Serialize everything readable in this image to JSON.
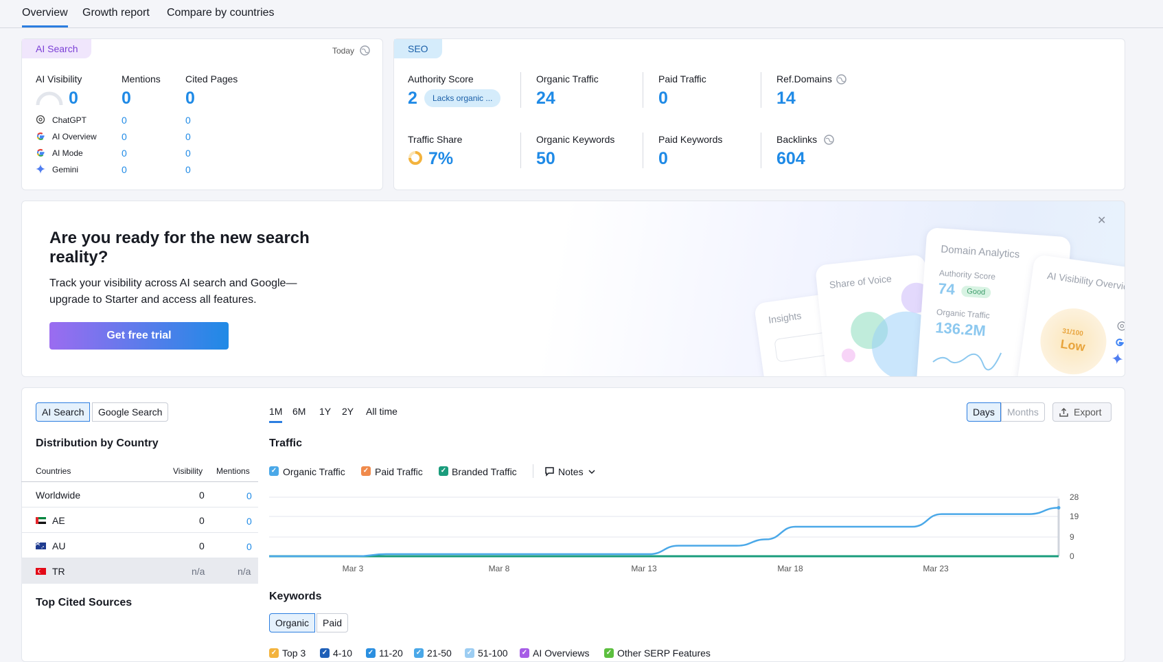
{
  "tabs": [
    "Overview",
    "Growth report",
    "Compare by countries"
  ],
  "ai_card": {
    "pill": "AI Search",
    "today": "Today",
    "cols": [
      "AI Visibility",
      "Mentions",
      "Cited Pages"
    ],
    "totals": [
      "0",
      "0",
      "0"
    ],
    "rows": [
      {
        "name": "ChatGPT",
        "mentions": "0",
        "cited": "0"
      },
      {
        "name": "AI Overview",
        "mentions": "0",
        "cited": "0"
      },
      {
        "name": "AI Mode",
        "mentions": "0",
        "cited": "0"
      },
      {
        "name": "Gemini",
        "mentions": "0",
        "cited": "0"
      }
    ]
  },
  "seo_card": {
    "pill": "SEO",
    "authority_label": "Authority Score",
    "authority_value": "2",
    "authority_chip": "Lacks organic ...",
    "organic_traffic_label": "Organic Traffic",
    "organic_traffic_value": "24",
    "paid_traffic_label": "Paid Traffic",
    "paid_traffic_value": "0",
    "ref_domains_label": "Ref.Domains",
    "ref_domains_value": "14",
    "traffic_share_label": "Traffic Share",
    "traffic_share_value": "7%",
    "organic_keywords_label": "Organic Keywords",
    "organic_keywords_value": "50",
    "paid_keywords_label": "Paid Keywords",
    "paid_keywords_value": "0",
    "backlinks_label": "Backlinks",
    "backlinks_value": "604"
  },
  "promo": {
    "title": "Are you ready for the new search reality?",
    "text": "Track your visibility across AI search and Google—upgrade to Starter and access all features.",
    "cta": "Get free trial",
    "illus": {
      "insights": "Insights",
      "share_of_voice": "Share of Voice",
      "domain_analytics": "Domain Analytics",
      "authority_score": "Authority Score",
      "authority_value": "74",
      "authority_badge": "Good",
      "organic_traffic": "Organic Traffic",
      "organic_value": "136.2M",
      "ai_visibility": "AI Visibility Overview",
      "gauge_score": "31",
      "gauge_of": "/100",
      "gauge_label": "Low"
    }
  },
  "bottom": {
    "source_toggle": [
      "AI Search",
      "Google Search"
    ],
    "distribution_title": "Distribution by Country",
    "table_headers": [
      "Countries",
      "Visibility",
      "Mentions"
    ],
    "countries": [
      {
        "name": "Worldwide",
        "visibility": "0",
        "mentions": "0"
      },
      {
        "name": "AE",
        "visibility": "0",
        "mentions": "0"
      },
      {
        "name": "AU",
        "visibility": "0",
        "mentions": "0"
      },
      {
        "name": "TR",
        "visibility": "n/a",
        "mentions": "n/a"
      }
    ],
    "top_cited_title": "Top Cited Sources",
    "periods": [
      "1M",
      "6M",
      "1Y",
      "2Y",
      "All time"
    ],
    "granularity": [
      "Days",
      "Months"
    ],
    "export_label": "Export",
    "traffic_title": "Traffic",
    "legend": [
      "Organic Traffic",
      "Paid Traffic",
      "Branded Traffic"
    ],
    "notes_label": "Notes",
    "keywords_title": "Keywords",
    "keyword_toggle": [
      "Organic",
      "Paid"
    ],
    "keyword_legend": [
      "Top 3",
      "4-10",
      "11-20",
      "21-50",
      "51-100",
      "AI Overviews",
      "Other SERP Features"
    ]
  },
  "chart_data": {
    "type": "line",
    "x_ticks": [
      "Mar 3",
      "Mar 8",
      "Mar 13",
      "Mar 18",
      "Mar 23"
    ],
    "y_ticks": [
      "28",
      "19",
      "9",
      "0"
    ],
    "ylim": [
      0,
      28
    ],
    "series": [
      {
        "name": "Organic Traffic",
        "color": "#4aa8e8",
        "x": [
          0,
          3,
          4,
          5,
          6,
          7,
          8,
          9,
          10,
          11,
          12,
          13,
          14,
          15,
          16,
          17,
          18,
          19,
          20,
          21,
          22,
          23,
          24,
          25,
          26,
          27
        ],
        "values": [
          0,
          0,
          1,
          1,
          1,
          1,
          1,
          1,
          1,
          1,
          1,
          1,
          5,
          5,
          5,
          8,
          14,
          14,
          14,
          14,
          14,
          20,
          20,
          20,
          20,
          23
        ]
      },
      {
        "name": "Paid Traffic",
        "color": "#f08a4b",
        "x": [
          0,
          27
        ],
        "values": [
          0,
          0
        ]
      },
      {
        "name": "Branded Traffic",
        "color": "#1a9c7c",
        "x": [
          0,
          27
        ],
        "values": [
          0,
          0
        ]
      }
    ],
    "colors": {
      "organic": "#4aa8e8",
      "paid": "#f08a4b",
      "branded": "#1a9c7c"
    }
  },
  "colors": {
    "accent": "#2b7de0",
    "value_blue": "#1f8ae6",
    "cta_start": "#9b6cf0",
    "cta_end": "#1f8ae6"
  }
}
